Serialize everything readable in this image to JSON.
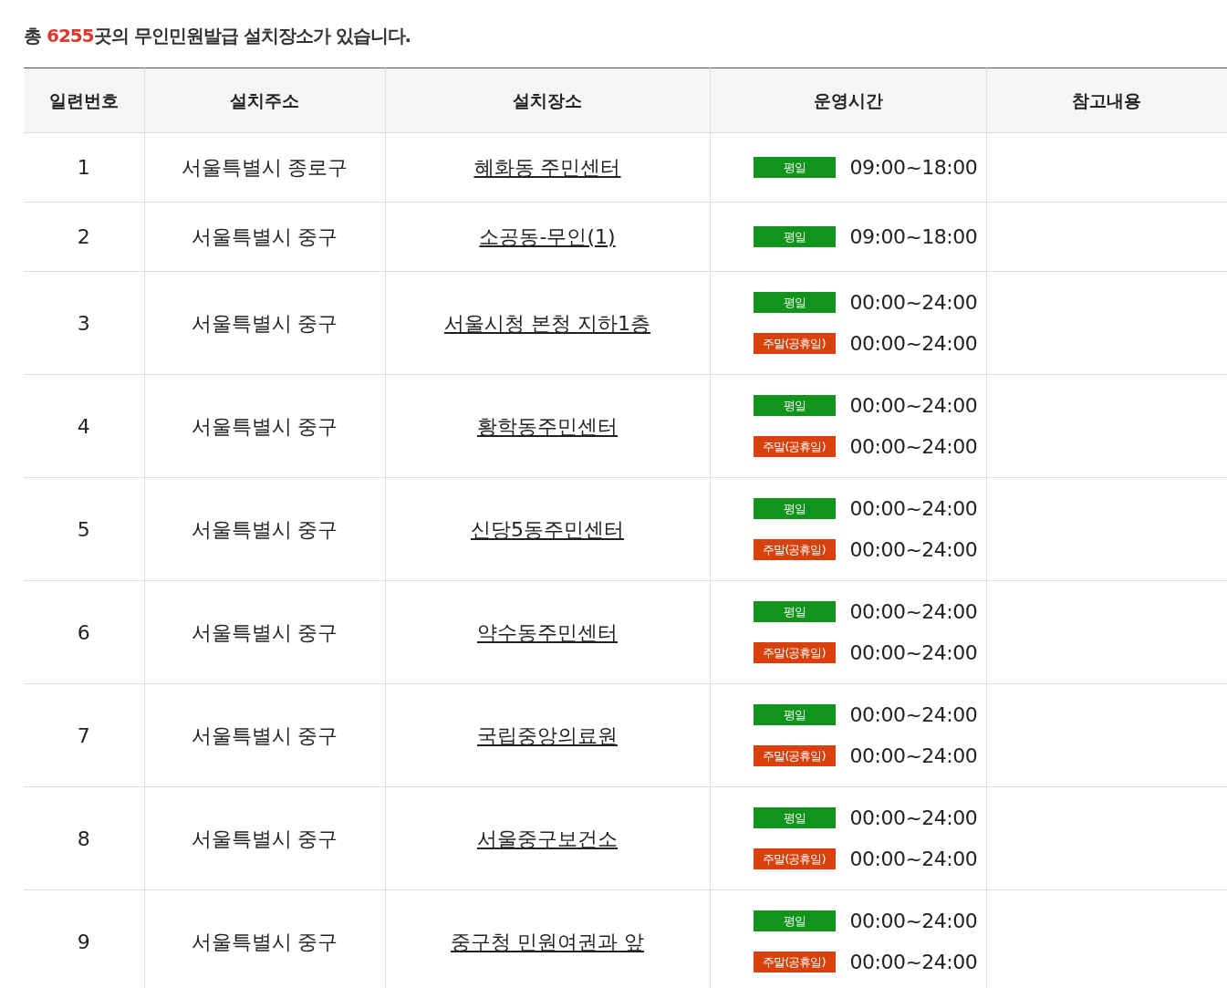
{
  "summary": {
    "prefix": "총 ",
    "count": "6255",
    "suffix": "곳의 무인민원발급 설치장소가 있습니다."
  },
  "table": {
    "columns": [
      "일련번호",
      "설치주소",
      "설치장소",
      "운영시간",
      "참고내용"
    ],
    "rows": [
      {
        "number": "1",
        "address": "서울특별시 종로구",
        "place": "혜화동 주민센터",
        "hours": [
          {
            "kind": "weekday",
            "label": "평일",
            "time": "09:00~18:00"
          }
        ]
      },
      {
        "number": "2",
        "address": "서울특별시 중구",
        "place": "소공동-무인(1)",
        "hours": [
          {
            "kind": "weekday",
            "label": "평일",
            "time": "09:00~18:00"
          }
        ]
      },
      {
        "number": "3",
        "address": "서울특별시 중구",
        "place": "서울시청 본청 지하1층",
        "hours": [
          {
            "kind": "weekday",
            "label": "평일",
            "time": "00:00~24:00"
          },
          {
            "kind": "weekend",
            "label": "주말(공휴일)",
            "time": "00:00~24:00"
          }
        ]
      },
      {
        "number": "4",
        "address": "서울특별시 중구",
        "place": "황학동주민센터",
        "hours": [
          {
            "kind": "weekday",
            "label": "평일",
            "time": "00:00~24:00"
          },
          {
            "kind": "weekend",
            "label": "주말(공휴일)",
            "time": "00:00~24:00"
          }
        ]
      },
      {
        "number": "5",
        "address": "서울특별시 중구",
        "place": "신당5동주민센터",
        "hours": [
          {
            "kind": "weekday",
            "label": "평일",
            "time": "00:00~24:00"
          },
          {
            "kind": "weekend",
            "label": "주말(공휴일)",
            "time": "00:00~24:00"
          }
        ]
      },
      {
        "number": "6",
        "address": "서울특별시 중구",
        "place": "약수동주민센터",
        "hours": [
          {
            "kind": "weekday",
            "label": "평일",
            "time": "00:00~24:00"
          },
          {
            "kind": "weekend",
            "label": "주말(공휴일)",
            "time": "00:00~24:00"
          }
        ]
      },
      {
        "number": "7",
        "address": "서울특별시 중구",
        "place": "국립중앙의료원",
        "hours": [
          {
            "kind": "weekday",
            "label": "평일",
            "time": "00:00~24:00"
          },
          {
            "kind": "weekend",
            "label": "주말(공휴일)",
            "time": "00:00~24:00"
          }
        ]
      },
      {
        "number": "8",
        "address": "서울특별시 중구",
        "place": "서울중구보건소",
        "hours": [
          {
            "kind": "weekday",
            "label": "평일",
            "time": "00:00~24:00"
          },
          {
            "kind": "weekend",
            "label": "주말(공휴일)",
            "time": "00:00~24:00"
          }
        ]
      },
      {
        "number": "9",
        "address": "서울특별시 중구",
        "place": "중구청 민원여권과 앞",
        "hours": [
          {
            "kind": "weekday",
            "label": "평일",
            "time": "00:00~24:00"
          },
          {
            "kind": "weekend",
            "label": "주말(공휴일)",
            "time": "00:00~24:00"
          }
        ]
      }
    ]
  }
}
